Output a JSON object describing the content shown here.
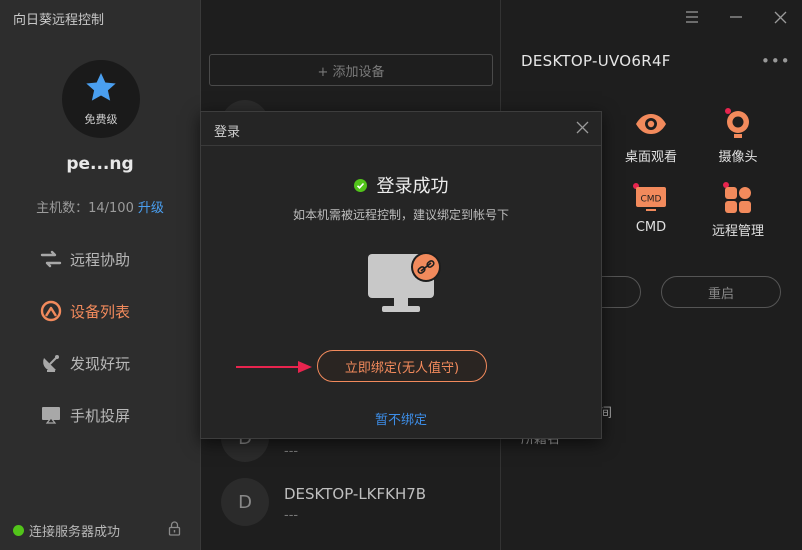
{
  "app": {
    "title": "向日葵远程控制"
  },
  "sidebar": {
    "tier": "免费级",
    "username": "pe...ng",
    "host_count": "主机数：14/100",
    "upgrade": "升级",
    "items": [
      {
        "label": "远程协助",
        "icon": "arrows-exchange-icon"
      },
      {
        "label": "设备列表",
        "icon": "device-list-icon",
        "active": true
      },
      {
        "label": "发现好玩",
        "icon": "satellite-dish-icon"
      },
      {
        "label": "手机投屏",
        "icon": "screen-cast-icon"
      }
    ],
    "status": "连接服务器成功"
  },
  "device_list": {
    "add_label": "+ 添加设备",
    "devices": [
      {
        "initial": "D",
        "name": "",
        "sub": "---"
      },
      {
        "initial": "D",
        "name": "DESKTOP-LKFKH7B",
        "sub": "---"
      }
    ]
  },
  "detail": {
    "title": "DESKTOP-UVO6R4F",
    "more": "•••",
    "features": [
      {
        "label": "桌面观看",
        "icon": "eye-icon"
      },
      {
        "label": "摄像头",
        "icon": "camera-icon"
      },
      {
        "label": "CMD",
        "icon": "cmd-icon",
        "badge": "CMD"
      },
      {
        "label": "远程管理",
        "icon": "apps-grid-icon"
      }
    ],
    "restart_label": "重启",
    "partial_text_1": "间",
    "partial_text_2": "所籍名"
  },
  "modal": {
    "title": "登录",
    "success": "登录成功",
    "hint": "如本机需被远程控制，建议绑定到帐号下",
    "bind_button": "立即绑定(无人值守)",
    "skip": "暂不绑定"
  },
  "colors": {
    "accent": "#f28a5c",
    "link": "#3d8ee8",
    "success": "#52c41a",
    "star": "#4a9ff0",
    "arrow": "#e8244e"
  }
}
